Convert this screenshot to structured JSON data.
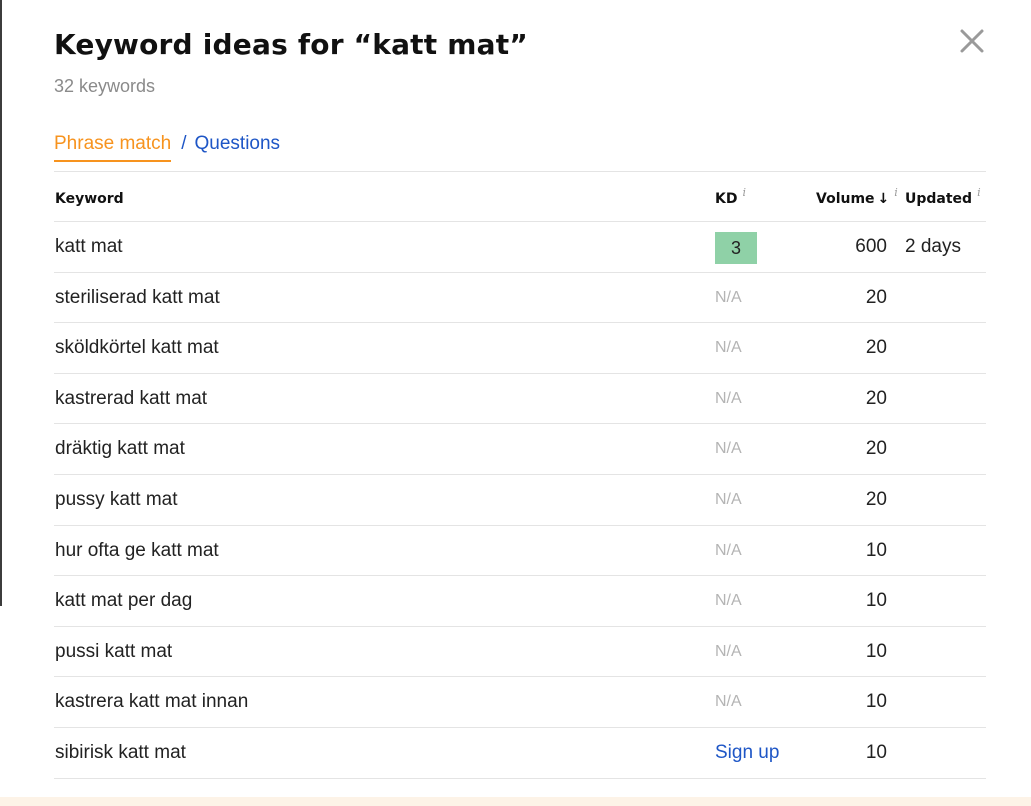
{
  "modal": {
    "title": "Keyword ideas for “katt mat”",
    "subtitle": "32 keywords"
  },
  "tabs": {
    "active": "Phrase match",
    "separator": "/",
    "other": "Questions"
  },
  "table": {
    "headers": {
      "keyword": "Keyword",
      "kd": "KD",
      "volume": "Volume",
      "volume_sort_arrow": "↓",
      "updated": "Updated",
      "info_glyph": "i"
    },
    "rows": [
      {
        "keyword": "katt mat",
        "kd": "3",
        "kd_type": "badge",
        "volume": "600",
        "updated": "2 days"
      },
      {
        "keyword": "steriliserad katt mat",
        "kd": "N/A",
        "kd_type": "na",
        "volume": "20",
        "updated": ""
      },
      {
        "keyword": "sköldkörtel katt mat",
        "kd": "N/A",
        "kd_type": "na",
        "volume": "20",
        "updated": ""
      },
      {
        "keyword": "kastrerad katt mat",
        "kd": "N/A",
        "kd_type": "na",
        "volume": "20",
        "updated": ""
      },
      {
        "keyword": "dräktig katt mat",
        "kd": "N/A",
        "kd_type": "na",
        "volume": "20",
        "updated": ""
      },
      {
        "keyword": "pussy katt mat",
        "kd": "N/A",
        "kd_type": "na",
        "volume": "20",
        "updated": ""
      },
      {
        "keyword": "hur ofta ge katt mat",
        "kd": "N/A",
        "kd_type": "na",
        "volume": "10",
        "updated": ""
      },
      {
        "keyword": "katt mat per dag",
        "kd": "N/A",
        "kd_type": "na",
        "volume": "10",
        "updated": ""
      },
      {
        "keyword": "pussi katt mat",
        "kd": "N/A",
        "kd_type": "na",
        "volume": "10",
        "updated": ""
      },
      {
        "keyword": "kastrera katt mat innan",
        "kd": "N/A",
        "kd_type": "na",
        "volume": "10",
        "updated": ""
      },
      {
        "keyword": "sibirisk katt mat",
        "kd": "Sign up",
        "kd_type": "link",
        "volume": "10",
        "updated": ""
      }
    ]
  },
  "colors": {
    "accent_orange": "#f7931e",
    "link_blue": "#1e56c6",
    "kd_badge_green": "#8fd1a7",
    "na_gray": "#b4b4b4"
  },
  "icons": {
    "close": "close-icon",
    "info": "info-icon",
    "sort": "sort-down-arrow-icon"
  }
}
